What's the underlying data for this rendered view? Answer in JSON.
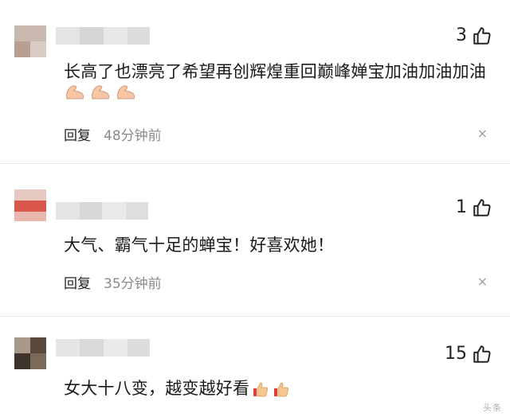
{
  "comments": [
    {
      "likes": "3",
      "text": "长高了也漂亮了希望再创辉煌重回巅峰婵宝加油加油加油",
      "emoji": [
        "flexed-biceps",
        "flexed-biceps",
        "flexed-biceps"
      ],
      "reply_label": "回复",
      "time": "48分钟前",
      "close_label": "×"
    },
    {
      "likes": "1",
      "text": "大气、霸气十足的蝉宝！好喜欢她！",
      "reply_label": "回复",
      "time": "35分钟前",
      "close_label": "×"
    },
    {
      "likes": "15",
      "text": "女大十八变，越变越好看",
      "emoji": [
        "thumbs-up",
        "thumbs-up"
      ]
    }
  ],
  "watermark": "头条"
}
